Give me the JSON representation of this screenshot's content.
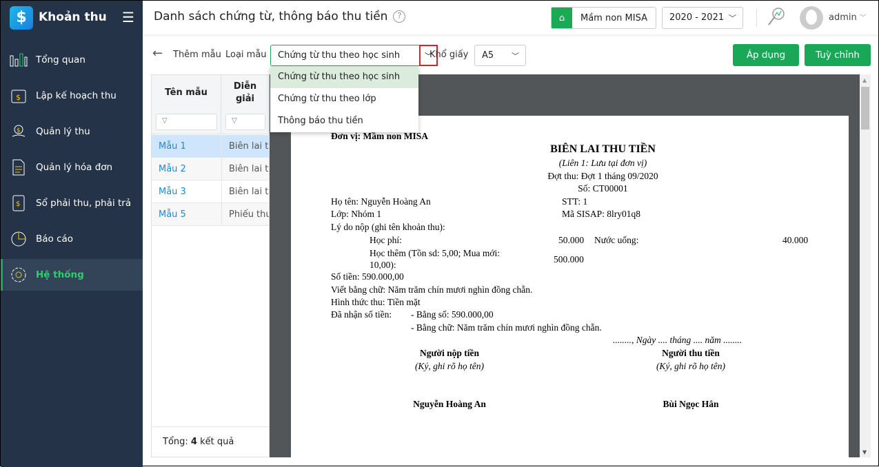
{
  "app": {
    "title": "Khoản thu",
    "logo": "$"
  },
  "sidebar": {
    "items": [
      {
        "label": "Tổng quan",
        "icon": "bar-chart-icon"
      },
      {
        "label": "Lập kế hoạch thu",
        "icon": "calendar-dollar-icon"
      },
      {
        "label": "Quản lý thu",
        "icon": "hand-coin-icon"
      },
      {
        "label": "Quản lý hóa đơn",
        "icon": "document-icon"
      },
      {
        "label": "Sổ phải thu, phải trả",
        "icon": "book-icon"
      },
      {
        "label": "Báo cáo",
        "icon": "pie-chart-icon"
      },
      {
        "label": "Hệ thống",
        "icon": "gear-icon",
        "active": true
      }
    ]
  },
  "header": {
    "title": "Danh sách chứng từ, thông báo thu tiền",
    "help": "?",
    "school": "Mầm non MISA",
    "year": "2020 - 2021",
    "user": "admin"
  },
  "toolbar": {
    "back_label": "Thêm mẫu",
    "type_label": "Loại mẫu",
    "type_value": "Chứng từ thu theo học sinh",
    "paper_label": "Khổ giấy",
    "paper_value": "A5",
    "apply": "Áp dụng",
    "customize": "Tuỳ chỉnh"
  },
  "dropdown": {
    "options": [
      "Chứng từ thu theo học sinh",
      "Chứng từ thu theo lớp",
      "Thông báo thu tiền"
    ]
  },
  "table": {
    "headers": [
      "Tên mẫu",
      "Diễn giải"
    ],
    "rows": [
      [
        "Mẫu 1",
        "Biên lai thu tiền"
      ],
      [
        "Mẫu 2",
        "Biên lai thu tiền"
      ],
      [
        "Mẫu 3",
        "Biên lai thu tiền"
      ],
      [
        "Mẫu 5",
        "Phiếu thu"
      ]
    ],
    "total_prefix": "Tổng: ",
    "total_count": "4",
    "total_suffix": " kết quả"
  },
  "receipt": {
    "unit": "Đơn vị: Mầm non MISA",
    "title": "BIÊN LAI THU TIỀN",
    "copy": "(Liên 1: Lưu tại đơn vị)",
    "period": "Đợt thu: Đợt 1 tháng 09/2020",
    "number": "Số: CT00001",
    "name": "Họ tên: Nguyễn Hoàng An",
    "stt": "STT: 1",
    "class": "Lớp: Nhóm 1",
    "sisap": "Mã SISAP: 8lry01q8",
    "reason": "Lý do nộp (ghi tên khoản thu):",
    "fee1": "Học phí:",
    "fee1_val": "50.000",
    "fee2": "Nước uống:",
    "fee2_val": "40.000",
    "fee3a": "Học thêm (Tồn sd: 5,00; Mua mới:",
    "fee3b": "10,00):",
    "fee3_val": "500.000",
    "amount": "Số tiền: 590.000,00",
    "words": "Viết bằng chữ: Năm trăm chín mươi nghìn đồng chẵn.",
    "method": "Hình thức thu: Tiền mặt",
    "received": "Đã nhận số tiền:",
    "recv_num": "- Bằng số: 590.000,00",
    "recv_words": "- Bằng chữ: Năm trăm chín mươi nghìn đồng chẵn.",
    "date": "........, Ngày .... tháng .... năm ........",
    "payer": "Người nộp tiền",
    "payer_note": "(Ký, ghi rõ họ tên)",
    "collector": "Người thu tiền",
    "collector_note": "(Ký, ghi rõ họ tên)",
    "payer_name": "Nguyễn Hoàng An",
    "collector_name": "Bùi Ngọc Hân"
  }
}
